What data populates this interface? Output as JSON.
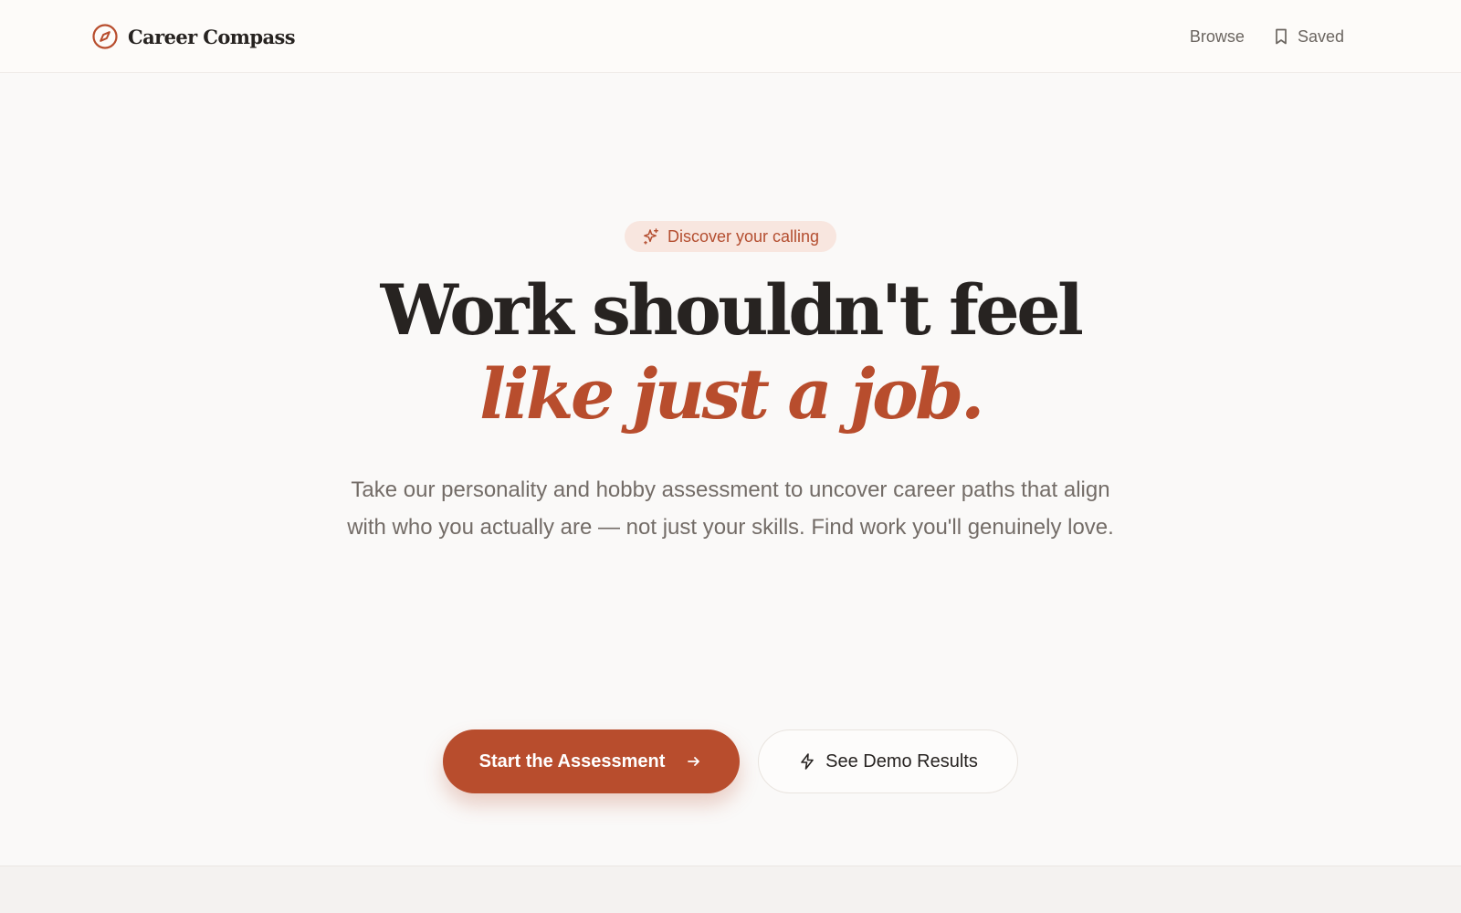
{
  "header": {
    "brand_name": "Career Compass",
    "brand_icon": "compass-icon",
    "nav": [
      {
        "label": "Browse",
        "icon": null
      },
      {
        "label": "Saved",
        "icon": "bookmark-icon"
      }
    ]
  },
  "hero": {
    "badge_label": "Discover your calling",
    "badge_icon": "sparkles-icon",
    "headline_line1": "Work shouldn't feel",
    "headline_line2": "like just a job.",
    "subtitle": "Take our personality and hobby assessment to uncover career paths that align with who you actually are — not just your skills. Find work you'll genuinely love.",
    "primary_cta": "Start the Assessment",
    "primary_cta_icon": "arrow-right-icon",
    "secondary_cta": "See Demo Results",
    "secondary_cta_icon": "lightning-icon"
  },
  "colors": {
    "accent": "#b84d2d",
    "badge_bg": "#f8e6df",
    "text_dark": "#272321",
    "text_muted": "#736c67",
    "page_bg": "#faf9f8"
  }
}
